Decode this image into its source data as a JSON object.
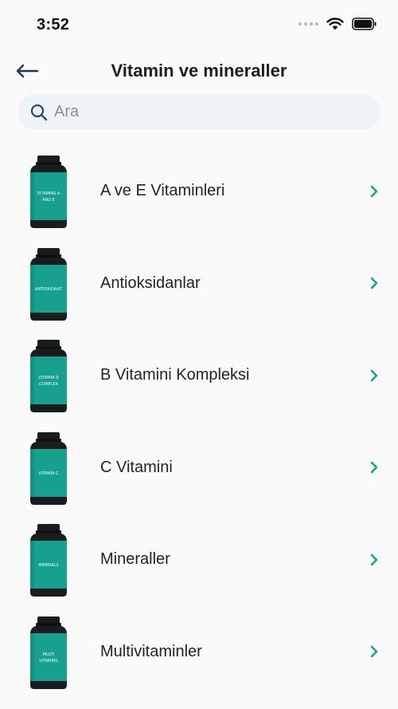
{
  "status": {
    "time": "3:52"
  },
  "header": {
    "title": "Vitamin ve mineraller"
  },
  "search": {
    "placeholder": "Ara"
  },
  "colors": {
    "accent": "#16a293",
    "bottle_label": "#17a08e",
    "bottle_cap": "#1a1d1f"
  },
  "items": [
    {
      "label": "A ve E Vitaminleri",
      "bottle_text": [
        "VITAMINS A",
        "AND E"
      ]
    },
    {
      "label": "Antioksidanlar",
      "bottle_text": [
        "ANTIOXIDANT"
      ]
    },
    {
      "label": "B Vitamini Kompleksi",
      "bottle_text": [
        "VITAMIN B",
        "COMPLEX"
      ]
    },
    {
      "label": "C Vitamini",
      "bottle_text": [
        "VITAMIN C"
      ]
    },
    {
      "label": "Mineraller",
      "bottle_text": [
        "MINERALS"
      ]
    },
    {
      "label": "Multivitaminler",
      "bottle_text": [
        "MULTI",
        "VITAMINS"
      ]
    }
  ]
}
